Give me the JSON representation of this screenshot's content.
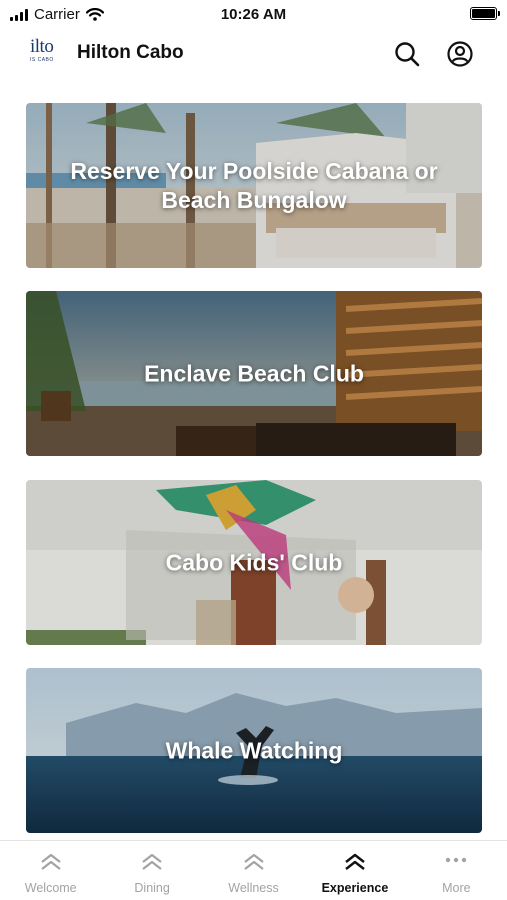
{
  "status_bar": {
    "carrier": "Carrier",
    "time": "10:26 AM"
  },
  "header": {
    "logo_text": "ilto",
    "logo_subtext": "IS CABO",
    "title": "Hilton Cabo",
    "icons": [
      "search-icon",
      "account-icon"
    ]
  },
  "cards": [
    {
      "title": "Reserve Your Poolside Cabana or Beach Bungalow"
    },
    {
      "title": "Enclave Beach Club"
    },
    {
      "title": "Cabo Kids' Club"
    },
    {
      "title": "Whale Watching"
    }
  ],
  "tabs": [
    {
      "label": "Welcome",
      "icon": "double-chevron-up-icon",
      "active": false
    },
    {
      "label": "Dining",
      "icon": "double-chevron-up-icon",
      "active": false
    },
    {
      "label": "Wellness",
      "icon": "double-chevron-up-icon",
      "active": false
    },
    {
      "label": "Experience",
      "icon": "double-chevron-up-icon",
      "active": true
    },
    {
      "label": "More",
      "icon": "more-dots-icon",
      "active": false
    }
  ],
  "colors": {
    "active_tab": "#111111",
    "inactive_tab": "#a3a3a3",
    "brand": "#1c3b6b"
  }
}
